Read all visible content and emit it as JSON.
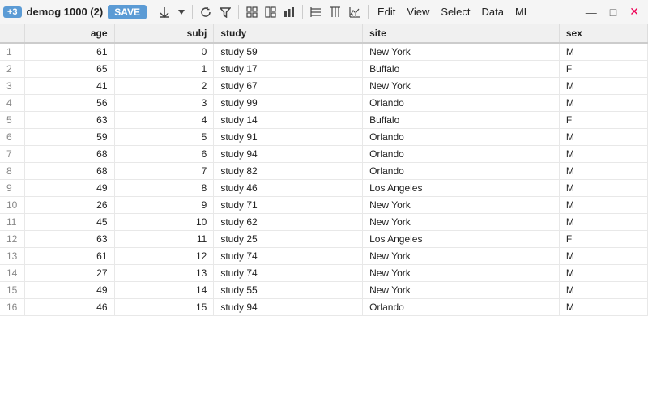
{
  "toolbar": {
    "badge": "+3",
    "filename": "demog 1000 (2)",
    "save_label": "SAVE",
    "menus": [
      "Edit",
      "View",
      "Select",
      "Data",
      "ML"
    ],
    "window_min": "—",
    "window_max": "□",
    "window_close": "✕"
  },
  "table": {
    "columns": [
      {
        "key": "row",
        "label": ""
      },
      {
        "key": "age",
        "label": "age"
      },
      {
        "key": "subj",
        "label": "subj"
      },
      {
        "key": "study",
        "label": "study"
      },
      {
        "key": "site",
        "label": "site"
      },
      {
        "key": "sex",
        "label": "sex"
      }
    ],
    "rows": [
      {
        "row": 1,
        "age": 61,
        "subj": 0,
        "study": "study 59",
        "site": "New York",
        "sex": "M"
      },
      {
        "row": 2,
        "age": 65,
        "subj": 1,
        "study": "study 17",
        "site": "Buffalo",
        "sex": "F"
      },
      {
        "row": 3,
        "age": 41,
        "subj": 2,
        "study": "study 67",
        "site": "New York",
        "sex": "M"
      },
      {
        "row": 4,
        "age": 56,
        "subj": 3,
        "study": "study 99",
        "site": "Orlando",
        "sex": "M"
      },
      {
        "row": 5,
        "age": 63,
        "subj": 4,
        "study": "study 14",
        "site": "Buffalo",
        "sex": "F"
      },
      {
        "row": 6,
        "age": 59,
        "subj": 5,
        "study": "study 91",
        "site": "Orlando",
        "sex": "M"
      },
      {
        "row": 7,
        "age": 68,
        "subj": 6,
        "study": "study 94",
        "site": "Orlando",
        "sex": "M"
      },
      {
        "row": 8,
        "age": 68,
        "subj": 7,
        "study": "study 82",
        "site": "Orlando",
        "sex": "M"
      },
      {
        "row": 9,
        "age": 49,
        "subj": 8,
        "study": "study 46",
        "site": "Los Angeles",
        "sex": "M"
      },
      {
        "row": 10,
        "age": 26,
        "subj": 9,
        "study": "study 71",
        "site": "New York",
        "sex": "M"
      },
      {
        "row": 11,
        "age": 45,
        "subj": 10,
        "study": "study 62",
        "site": "New York",
        "sex": "M"
      },
      {
        "row": 12,
        "age": 63,
        "subj": 11,
        "study": "study 25",
        "site": "Los Angeles",
        "sex": "F"
      },
      {
        "row": 13,
        "age": 61,
        "subj": 12,
        "study": "study 74",
        "site": "New York",
        "sex": "M"
      },
      {
        "row": 14,
        "age": 27,
        "subj": 13,
        "study": "study 74",
        "site": "New York",
        "sex": "M"
      },
      {
        "row": 15,
        "age": 49,
        "subj": 14,
        "study": "study 55",
        "site": "New York",
        "sex": "M"
      },
      {
        "row": 16,
        "age": 46,
        "subj": 15,
        "study": "study 94",
        "site": "Orlando",
        "sex": "M"
      }
    ]
  }
}
